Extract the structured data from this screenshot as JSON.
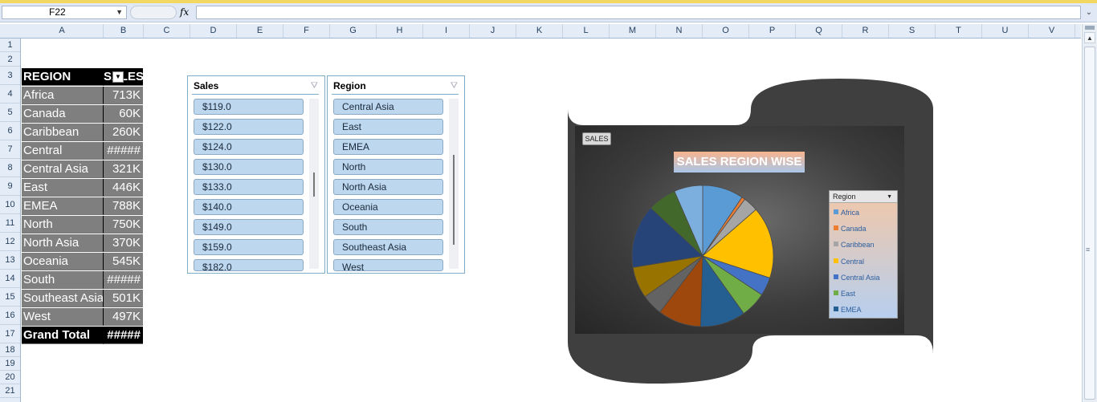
{
  "formula_bar": {
    "name_box": "F22",
    "fx_label": "fx",
    "formula_value": ""
  },
  "columns": [
    "A",
    "B",
    "C",
    "D",
    "E",
    "F",
    "G",
    "H",
    "I",
    "J",
    "K",
    "L",
    "M",
    "N",
    "O",
    "P",
    "Q",
    "R",
    "S",
    "T",
    "U",
    "V"
  ],
  "rows": [
    "1",
    "2",
    "3",
    "4",
    "5",
    "6",
    "7",
    "8",
    "9",
    "10",
    "11",
    "12",
    "13",
    "14",
    "15",
    "16",
    "17",
    "18",
    "19",
    "20",
    "21"
  ],
  "pivot": {
    "header_region": "REGION",
    "header_sales": "SALES",
    "rows": [
      {
        "region": "Africa",
        "sales": "713K"
      },
      {
        "region": "Canada",
        "sales": "60K"
      },
      {
        "region": "Caribbean",
        "sales": "260K"
      },
      {
        "region": "Central",
        "sales": "#####"
      },
      {
        "region": "Central Asia",
        "sales": "321K"
      },
      {
        "region": "East",
        "sales": "446K"
      },
      {
        "region": "EMEA",
        "sales": "788K"
      },
      {
        "region": "North",
        "sales": "750K"
      },
      {
        "region": "North Asia",
        "sales": "370K"
      },
      {
        "region": "Oceania",
        "sales": "545K"
      },
      {
        "region": "South",
        "sales": "#####"
      },
      {
        "region": "Southeast Asia",
        "sales": "501K"
      },
      {
        "region": "West",
        "sales": "497K"
      }
    ],
    "total_label": "Grand Total",
    "total_value": "#####"
  },
  "slicer_sales": {
    "title": "Sales",
    "items": [
      "$119.0",
      "$122.0",
      "$124.0",
      "$130.0",
      "$133.0",
      "$140.0",
      "$149.0",
      "$159.0",
      "$182.0"
    ]
  },
  "slicer_region": {
    "title": "Region",
    "items": [
      "Central Asia",
      "East",
      "EMEA",
      "North",
      "North Asia",
      "Oceania",
      "South",
      "Southeast Asia",
      "West"
    ]
  },
  "chart": {
    "field_button": "SALES",
    "title": "SALES REGION WISE",
    "legend_title": "Region",
    "legend_items": [
      "Africa",
      "Canada",
      "Caribbean",
      "Central",
      "Central Asia",
      "East",
      "EMEA"
    ]
  },
  "chart_data": {
    "type": "pie",
    "title": "SALES REGION WISE",
    "categories": [
      "Africa",
      "Canada",
      "Caribbean",
      "Central",
      "Central Asia",
      "East",
      "EMEA",
      "North",
      "North Asia",
      "Oceania",
      "South",
      "Southeast Asia",
      "West"
    ],
    "values": [
      713,
      60,
      260,
      1250,
      321,
      446,
      788,
      750,
      370,
      545,
      1100,
      501,
      497
    ],
    "colors": [
      "#5b9bd5",
      "#ed7d31",
      "#a5a5a5",
      "#ffc000",
      "#4472c4",
      "#70ad47",
      "#255e91",
      "#9e480e",
      "#636363",
      "#997300",
      "#264478",
      "#43682b",
      "#7cafdd"
    ],
    "legend_position": "right"
  }
}
